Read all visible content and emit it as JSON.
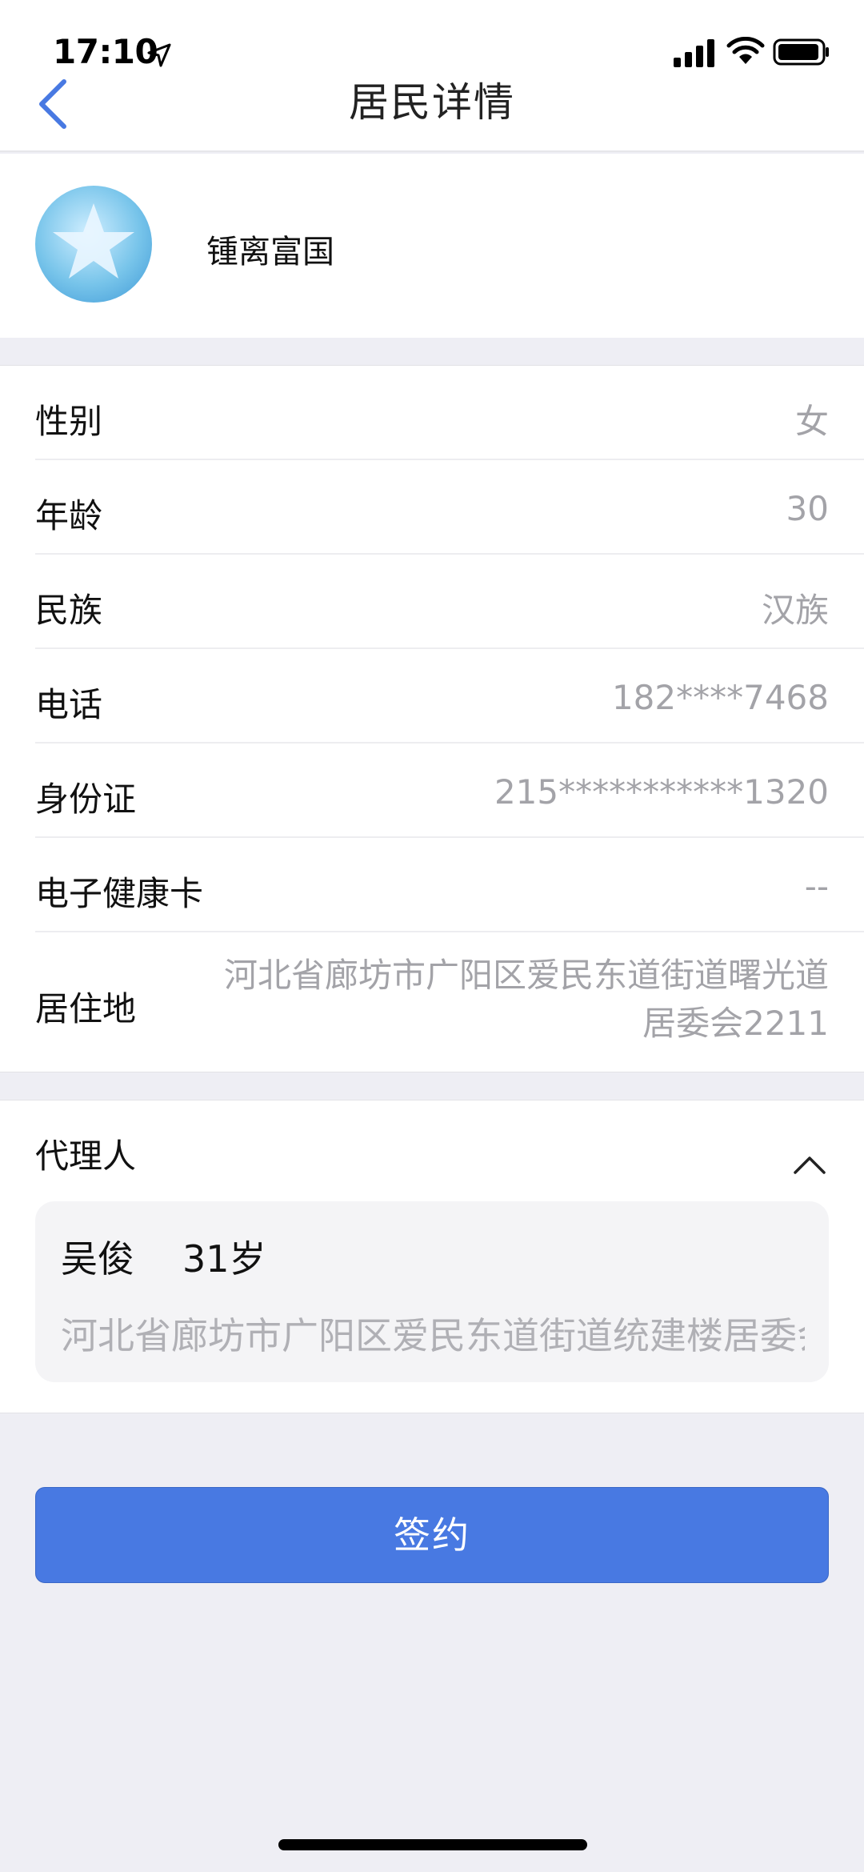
{
  "status_bar": {
    "time": "17:10"
  },
  "nav": {
    "title": "居民详情"
  },
  "profile": {
    "name": "锺离富国"
  },
  "info_rows": [
    {
      "label": "性别",
      "value": "女"
    },
    {
      "label": "年龄",
      "value": "30"
    },
    {
      "label": "民族",
      "value": "汉族"
    },
    {
      "label": "电话",
      "value": "182****7468"
    },
    {
      "label": "身份证",
      "value": "215***********1320"
    },
    {
      "label": "电子健康卡",
      "value": "--"
    },
    {
      "label": "居住地",
      "value": "河北省廊坊市广阳区爱民东道街道曙光道居委会2211"
    }
  ],
  "agent": {
    "title": "代理人",
    "name": "吴俊",
    "age": "31岁",
    "address": "河北省廊坊市广阳区爱民东道街道统建楼居委会"
  },
  "actions": {
    "sign_label": "签约"
  },
  "colors": {
    "accent": "#4879e2",
    "background": "#eeeef4",
    "muted_text": "#a3a3a8"
  }
}
